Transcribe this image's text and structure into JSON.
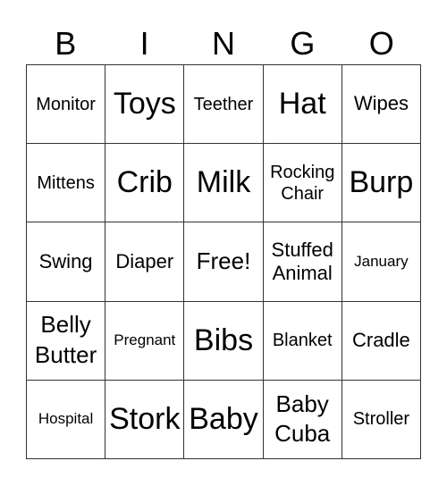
{
  "header": [
    "B",
    "I",
    "N",
    "G",
    "O"
  ],
  "cells": [
    "Monitor",
    "Toys",
    "Teether",
    "Hat",
    "Wipes",
    "Mittens",
    "Crib",
    "Milk",
    "Rocking\nChair",
    "Burp",
    "Swing",
    "Diaper",
    "Free!",
    "Stuffed\nAnimal",
    "January",
    "Belly\nButter",
    "Pregnant",
    "Bibs",
    "Blanket",
    "Cradle",
    "Hospital",
    "Stork",
    "Baby",
    "Baby\nCuba",
    "Stroller"
  ]
}
